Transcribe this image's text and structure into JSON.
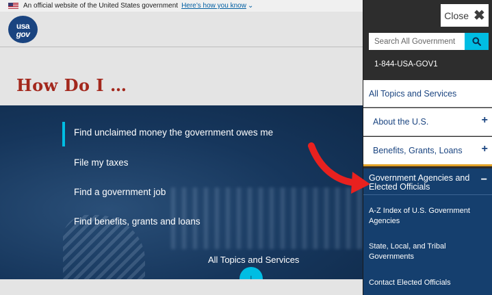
{
  "gov_banner": {
    "text": "An official website of the United States government",
    "link": "Here’s how you know",
    "chevron": "⌄"
  },
  "logo": {
    "line1": "usa",
    "line2": "gov"
  },
  "page_title": "How Do I …",
  "hero": {
    "items": [
      "Find unclaimed money the government owes me",
      "File my taxes",
      "Find a government job",
      "Find benefits, grants and loans"
    ],
    "all_topics": "All Topics and Services",
    "down_arrow": "↓"
  },
  "side_menu": {
    "close_label": "Close",
    "close_glyph": "✖",
    "search_placeholder": "Search All Government",
    "phone": "1-844-USA-GOV1",
    "links": {
      "all": "All Topics and Services",
      "about": "About the U.S.",
      "benefits": "Benefits, Grants, Loans",
      "plus": "+"
    },
    "expanded": {
      "title": "Government Agencies and Elected Officials",
      "minus": "−",
      "sub": [
        "A-Z Index of U.S. Government Agencies",
        "State, Local, and Tribal Governments",
        "Contact Elected Officials"
      ]
    }
  },
  "colors": {
    "accent": "#00bde3",
    "title_red": "#a3281d",
    "navy": "#153f6e",
    "annotation_red": "#e8211f"
  }
}
